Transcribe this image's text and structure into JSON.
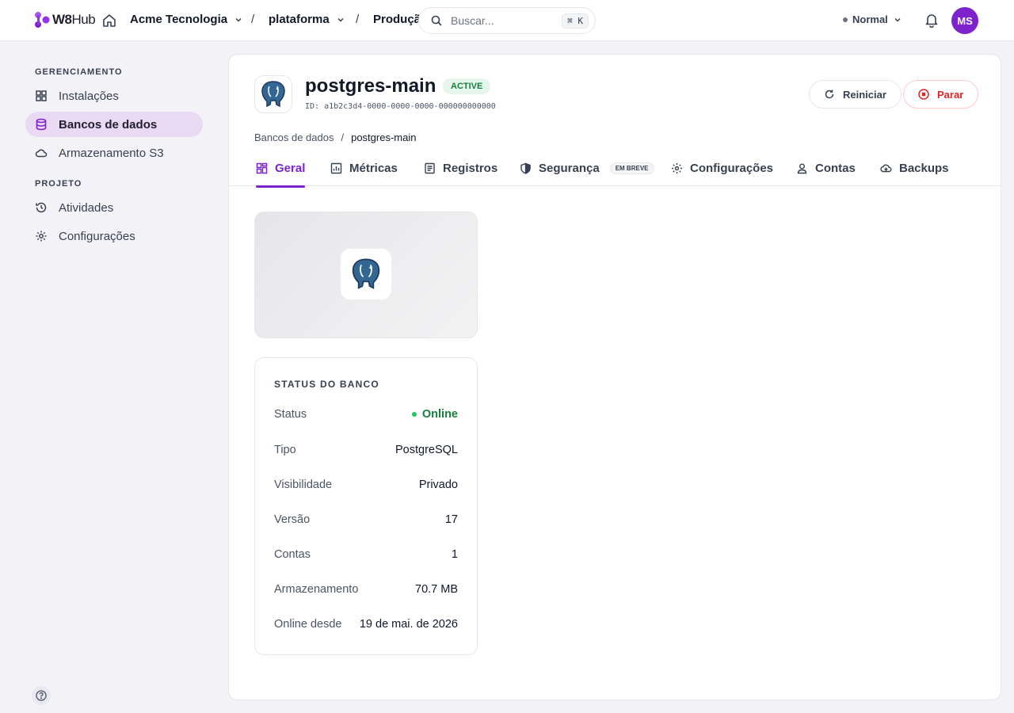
{
  "topbar": {
    "brand": {
      "prefix": "W8",
      "suffix": "Hub"
    },
    "org": "Acme Tecnologia",
    "project": "plataforma",
    "environment": "Produção",
    "separator": "/",
    "search_placeholder": "Buscar...",
    "search_shortcut": "⌘ K",
    "mode": "Normal",
    "avatar_initials": "MS"
  },
  "sidebar": {
    "sections": [
      {
        "label": "GERENCIAMENTO"
      },
      {
        "label": "PROJETO"
      }
    ],
    "items": [
      {
        "label": "Instalações",
        "icon": "grid-icon"
      },
      {
        "label": "Bancos de dados",
        "icon": "database-icon",
        "active": true
      },
      {
        "label": "Armazenamento S3",
        "icon": "cloud-icon"
      },
      {
        "label": "Atividades",
        "icon": "history-icon"
      },
      {
        "label": "Configurações",
        "icon": "gear-icon"
      }
    ]
  },
  "header": {
    "title": "postgres-main",
    "status_badge": "ACTIVE",
    "id_text": "ID: a1b2c3d4-0000-0000-0000-000000000000",
    "restart_label": "Reiniciar",
    "stop_label": "Parar",
    "breadcrumb": [
      "Bancos de dados",
      "postgres-main"
    ],
    "breadcrumb_sep": "/"
  },
  "tabs": [
    {
      "label": "Geral",
      "icon": "layout-icon",
      "active": true
    },
    {
      "label": "Métricas",
      "icon": "chart-icon"
    },
    {
      "label": "Registros",
      "icon": "document-icon"
    },
    {
      "label": "Segurança",
      "icon": "shield-icon",
      "badge": "EM BREVE"
    },
    {
      "label": "Configurações",
      "icon": "gear-icon"
    },
    {
      "label": "Contas",
      "icon": "user-icon"
    },
    {
      "label": "Backups",
      "icon": "cloud-upload-icon"
    }
  ],
  "status_card": {
    "title": "STATUS DO BANCO",
    "rows": [
      {
        "key": "Status",
        "value": "Online"
      },
      {
        "key": "Tipo",
        "value": "PostgreSQL"
      },
      {
        "key": "Visibilidade",
        "value": "Privado"
      },
      {
        "key": "Versão",
        "value": "17"
      },
      {
        "key": "Contas",
        "value": "1"
      },
      {
        "key": "Armazenamento",
        "value": "70.7 MB"
      },
      {
        "key": "Online desde",
        "value": "19 de mai. de 2026"
      }
    ]
  },
  "colors": {
    "accent": "#7e22ce",
    "active_bg": "#ead9f2",
    "online": "#15803d",
    "danger": "#dc2626"
  }
}
